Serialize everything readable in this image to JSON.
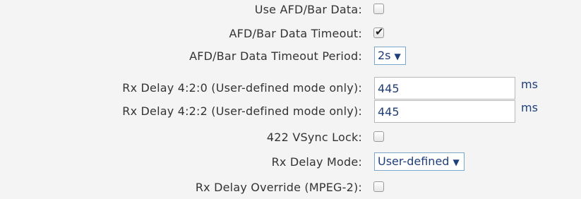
{
  "fields": {
    "use_afd_bar_data": {
      "label": "Use AFD/Bar Data:",
      "checked": false
    },
    "afd_bar_data_timeout": {
      "label": "AFD/Bar Data Timeout:",
      "checked": true,
      "check_glyph": "✔"
    },
    "afd_bar_data_timeout_period": {
      "label": "AFD/Bar Data Timeout Period:",
      "selected": "2s",
      "arrow": "▼"
    },
    "rx_delay_420": {
      "label": "Rx Delay 4:2:0 (User-defined mode only):",
      "value": "445",
      "unit": "ms"
    },
    "rx_delay_422": {
      "label": "Rx Delay 4:2:2 (User-defined mode only):",
      "value": "445",
      "unit": "ms"
    },
    "vsync_lock_422": {
      "label": "422 VSync Lock:",
      "checked": false
    },
    "rx_delay_mode": {
      "label": "Rx Delay Mode:",
      "selected": "User-defined",
      "arrow": "▼"
    },
    "rx_delay_override": {
      "label": "Rx Delay Override (MPEG-2):",
      "checked": false
    }
  },
  "colors": {
    "background": "#f4f4f4",
    "label_text": "#333333",
    "value_text": "#1f3f7a",
    "select_border": "#7aa6c9"
  }
}
